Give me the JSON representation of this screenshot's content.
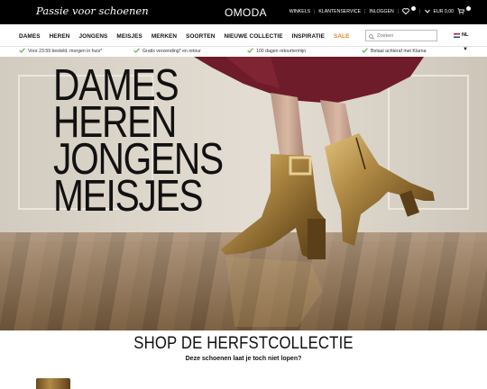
{
  "topbar": {
    "tagline": "Passie voor schoenen",
    "logo": "OMODA",
    "links": [
      "WINKELS",
      "KLANTENSERVICE",
      "INLOGGEN"
    ],
    "cart_amount": "EUR 0,00"
  },
  "nav": {
    "items": [
      "DAMES",
      "HEREN",
      "JONGENS",
      "MEISJES",
      "MERKEN",
      "SOORTEN",
      "NIEUWE COLLECTIE",
      "INSPIRATIE",
      "SALE"
    ],
    "search_placeholder": "Zoeken",
    "language": "NL"
  },
  "usps": [
    "Voor 23:59 besteld, morgen in huis*",
    "Gratis verzending* en retour",
    "100 dagen retourtermijn",
    "Betaal achteraf met Klarna"
  ],
  "hero": {
    "lines": [
      "DAMES",
      "HEREN",
      "JONGENS",
      "MEISJES"
    ]
  },
  "section": {
    "title": "SHOP DE HERFSTCOLLECTIE",
    "subtitle": "Deze schoenen laat je toch niet lopen?"
  },
  "colors": {
    "topbar_bg": "#000000",
    "sale": "#e8861a",
    "check": "#6aa84f"
  }
}
